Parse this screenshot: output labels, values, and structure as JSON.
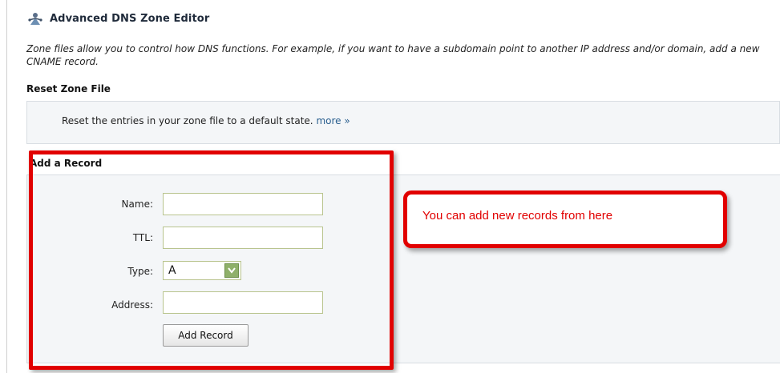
{
  "header": {
    "title": "Advanced DNS Zone Editor",
    "icon": "dns-zone-editor-icon",
    "description": "Zone files allow you to control how DNS functions. For example, if you want to have a subdomain point to another IP address and/or domain, add a new CNAME record."
  },
  "reset_section": {
    "heading": "Reset Zone File",
    "text": "Reset the entries in your zone file to a default state.",
    "more_link": "more »"
  },
  "add_record_section": {
    "heading": "Add a Record",
    "fields": {
      "name": {
        "label": "Name:",
        "value": ""
      },
      "ttl": {
        "label": "TTL:",
        "value": ""
      },
      "type": {
        "label": "Type:",
        "selected": "A"
      },
      "address": {
        "label": "Address:",
        "value": ""
      }
    },
    "submit_label": "Add Record"
  },
  "annotation": {
    "callout_text": "You can add new records from here",
    "color": "#e10000"
  }
}
